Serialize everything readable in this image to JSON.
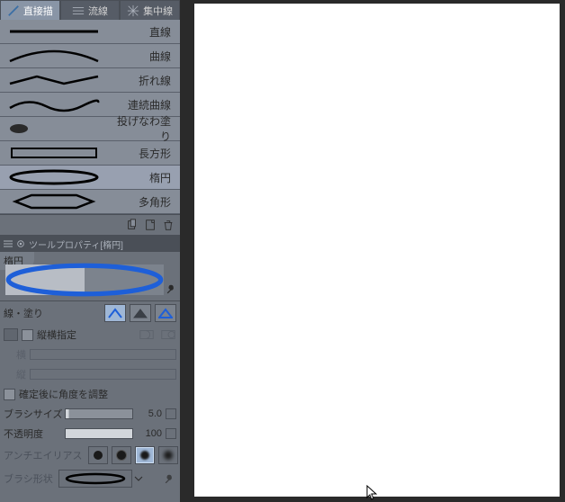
{
  "tabs": {
    "direct": "直接描",
    "stream": "流線",
    "focus": "集中線"
  },
  "tools": {
    "line": "直線",
    "curve": "曲線",
    "polyline": "折れ線",
    "continuous_curve": "連続曲線",
    "lasso_fill": "投げなわ塗り",
    "rectangle": "長方形",
    "ellipse": "楕円",
    "polygon": "多角形"
  },
  "panel_header": "ツールプロパティ[楕円]",
  "ellipse_title": "楕円",
  "props": {
    "line_fill": "線・塗り",
    "aspect_lock": "縦横指定",
    "width": "横",
    "height": "縦",
    "rotate_after": "確定後に角度を調整",
    "brush_size": "ブラシサイズ",
    "brush_size_val": "5.0",
    "opacity": "不透明度",
    "opacity_val": "100",
    "antialias": "アンチエイリアス",
    "brush_shape": "ブラシ形状"
  }
}
